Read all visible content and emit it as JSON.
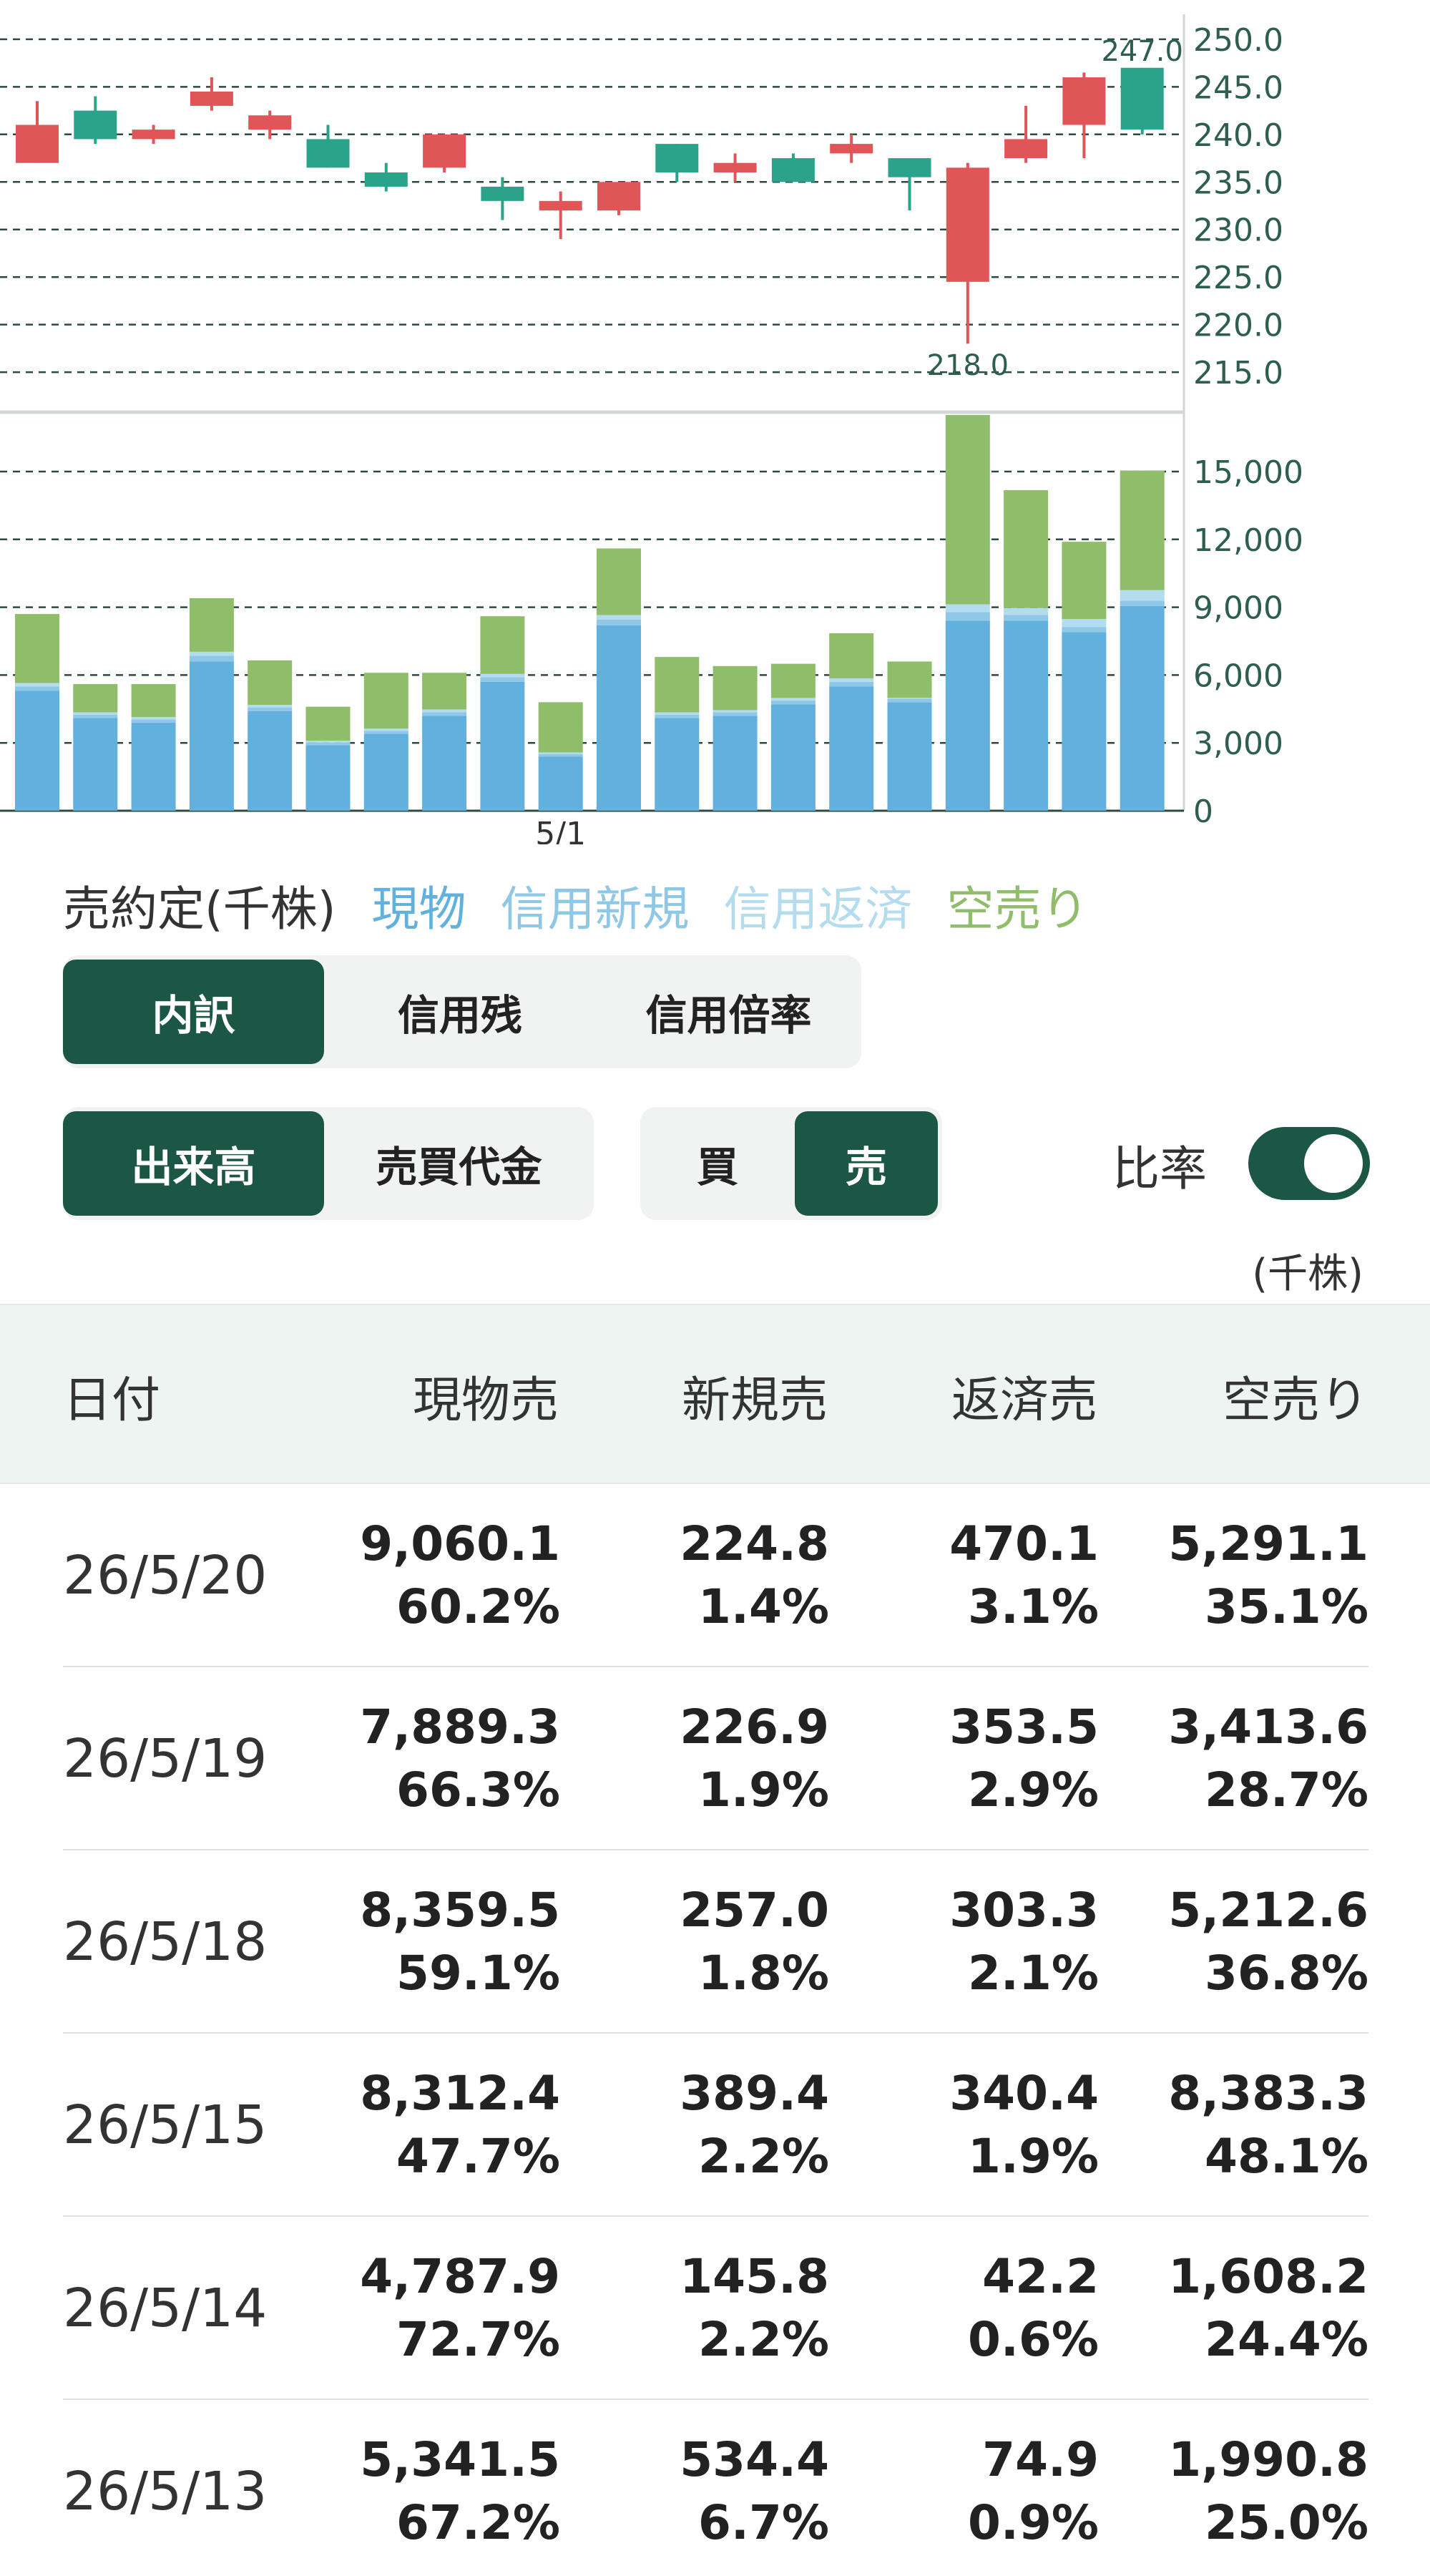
{
  "legend": {
    "title": "売約定(千株)",
    "items": [
      {
        "label": "現物",
        "color": "#62b0de"
      },
      {
        "label": "信用新規",
        "color": "#8ec8e6"
      },
      {
        "label": "信用返済",
        "color": "#b4dcef"
      },
      {
        "label": "空売り",
        "color": "#8fbd6a"
      }
    ]
  },
  "breakdown_tabs": [
    {
      "label": "内訳",
      "active": true
    },
    {
      "label": "信用残",
      "active": false
    },
    {
      "label": "信用倍率",
      "active": false
    }
  ],
  "metric_tabs": [
    {
      "label": "出来高",
      "active": true
    },
    {
      "label": "売買代金",
      "active": false
    }
  ],
  "side_tabs": [
    {
      "label": "買",
      "active": false
    },
    {
      "label": "売",
      "active": true
    }
  ],
  "ratio_toggle": {
    "label": "比率",
    "on": true
  },
  "unit_label": "(千株)",
  "table": {
    "headers": [
      "日付",
      "現物売",
      "新規売",
      "返済売",
      "空売り"
    ],
    "rows": [
      {
        "date": "26/5/20",
        "cash": "9,060.1",
        "cash_pct": "60.2%",
        "new": "224.8",
        "new_pct": "1.4%",
        "repay": "470.1",
        "repay_pct": "3.1%",
        "short": "5,291.1",
        "short_pct": "35.1%"
      },
      {
        "date": "26/5/19",
        "cash": "7,889.3",
        "cash_pct": "66.3%",
        "new": "226.9",
        "new_pct": "1.9%",
        "repay": "353.5",
        "repay_pct": "2.9%",
        "short": "3,413.6",
        "short_pct": "28.7%"
      },
      {
        "date": "26/5/18",
        "cash": "8,359.5",
        "cash_pct": "59.1%",
        "new": "257.0",
        "new_pct": "1.8%",
        "repay": "303.3",
        "repay_pct": "2.1%",
        "short": "5,212.6",
        "short_pct": "36.8%"
      },
      {
        "date": "26/5/15",
        "cash": "8,312.4",
        "cash_pct": "47.7%",
        "new": "389.4",
        "new_pct": "2.2%",
        "repay": "340.4",
        "repay_pct": "1.9%",
        "short": "8,383.3",
        "short_pct": "48.1%"
      },
      {
        "date": "26/5/14",
        "cash": "4,787.9",
        "cash_pct": "72.7%",
        "new": "145.8",
        "new_pct": "2.2%",
        "repay": "42.2",
        "repay_pct": "0.6%",
        "short": "1,608.2",
        "short_pct": "24.4%"
      },
      {
        "date": "26/5/13",
        "cash": "5,341.5",
        "cash_pct": "67.2%",
        "new": "534.4",
        "new_pct": "6.7%",
        "repay": "74.9",
        "repay_pct": "0.9%",
        "short": "1,990.8",
        "short_pct": "25.0%"
      }
    ]
  },
  "chart_data": [
    {
      "type": "candlestick",
      "ylim": [
        212,
        253
      ],
      "yticks": [
        "215.0",
        "220.0",
        "225.0",
        "230.0",
        "235.0",
        "240.0",
        "245.0",
        "250.0"
      ],
      "up_color": "#2aa38a",
      "down_color": "#e05557",
      "annotations": [
        {
          "label": "247.0",
          "index": 19,
          "value": 247.0,
          "position": "above"
        },
        {
          "label": "218.0",
          "index": 16,
          "value": 218.0,
          "position": "below"
        }
      ],
      "candles": [
        {
          "open": 241.0,
          "close": 237.0,
          "high": 243.5,
          "low": 237.0
        },
        {
          "open": 239.5,
          "close": 242.5,
          "high": 244.0,
          "low": 239.0
        },
        {
          "open": 240.5,
          "close": 239.5,
          "high": 241.0,
          "low": 239.0
        },
        {
          "open": 244.5,
          "close": 243.0,
          "high": 246.0,
          "low": 242.5
        },
        {
          "open": 242.0,
          "close": 240.5,
          "high": 242.5,
          "low": 239.5
        },
        {
          "open": 236.5,
          "close": 239.5,
          "high": 241.0,
          "low": 236.5
        },
        {
          "open": 234.5,
          "close": 236.0,
          "high": 237.0,
          "low": 234.0
        },
        {
          "open": 240.0,
          "close": 236.5,
          "high": 240.0,
          "low": 236.0
        },
        {
          "open": 233.0,
          "close": 234.5,
          "high": 235.5,
          "low": 231.0
        },
        {
          "open": 233.0,
          "close": 232.0,
          "high": 234.0,
          "low": 229.0
        },
        {
          "open": 235.0,
          "close": 232.0,
          "high": 235.0,
          "low": 231.5
        },
        {
          "open": 236.0,
          "close": 239.0,
          "high": 239.0,
          "low": 235.0
        },
        {
          "open": 237.0,
          "close": 236.0,
          "high": 238.0,
          "low": 235.0
        },
        {
          "open": 235.0,
          "close": 237.5,
          "high": 238.0,
          "low": 235.0
        },
        {
          "open": 239.0,
          "close": 238.0,
          "high": 240.0,
          "low": 237.0
        },
        {
          "open": 235.5,
          "close": 237.5,
          "high": 237.5,
          "low": 232.0
        },
        {
          "open": 236.5,
          "close": 224.5,
          "high": 237.0,
          "low": 218.0
        },
        {
          "open": 239.5,
          "close": 237.5,
          "high": 243.0,
          "low": 237.0
        },
        {
          "open": 246.0,
          "close": 241.0,
          "high": 246.5,
          "low": 237.5
        },
        {
          "open": 240.5,
          "close": 247.0,
          "high": 247.0,
          "low": 240.0
        }
      ]
    },
    {
      "type": "bar",
      "stacked": true,
      "ylim": [
        0,
        17500
      ],
      "yticks": [
        "0",
        "3,000",
        "6,000",
        "9,000",
        "12,000",
        "15,000"
      ],
      "x_label": {
        "label": "5/1",
        "index": 9
      },
      "series": [
        {
          "name": "現物",
          "color": "#62b0de",
          "values": [
            5300,
            4100,
            3900,
            6600,
            4400,
            2900,
            3400,
            4200,
            5700,
            2400,
            8200,
            4100,
            4200,
            4700,
            5500,
            4800,
            8400,
            8400,
            7900,
            9060
          ]
        },
        {
          "name": "信用新規",
          "color": "#8ec8e6",
          "values": [
            200,
            150,
            140,
            250,
            170,
            120,
            130,
            160,
            200,
            100,
            250,
            150,
            150,
            170,
            200,
            150,
            390,
            260,
            227,
            225
          ]
        },
        {
          "name": "信用返済",
          "color": "#b4dcef",
          "values": [
            150,
            100,
            100,
            180,
            110,
            80,
            100,
            120,
            150,
            80,
            200,
            100,
            100,
            120,
            150,
            42,
            340,
            303,
            354,
            470
          ]
        },
        {
          "name": "空売り",
          "color": "#8fbd6a",
          "values": [
            3050,
            1250,
            1460,
            2370,
            1970,
            1500,
            2470,
            1620,
            2550,
            2220,
            2950,
            2450,
            1950,
            1510,
            2000,
            1608,
            8383,
            5213,
            3414,
            5291
          ]
        }
      ]
    }
  ]
}
